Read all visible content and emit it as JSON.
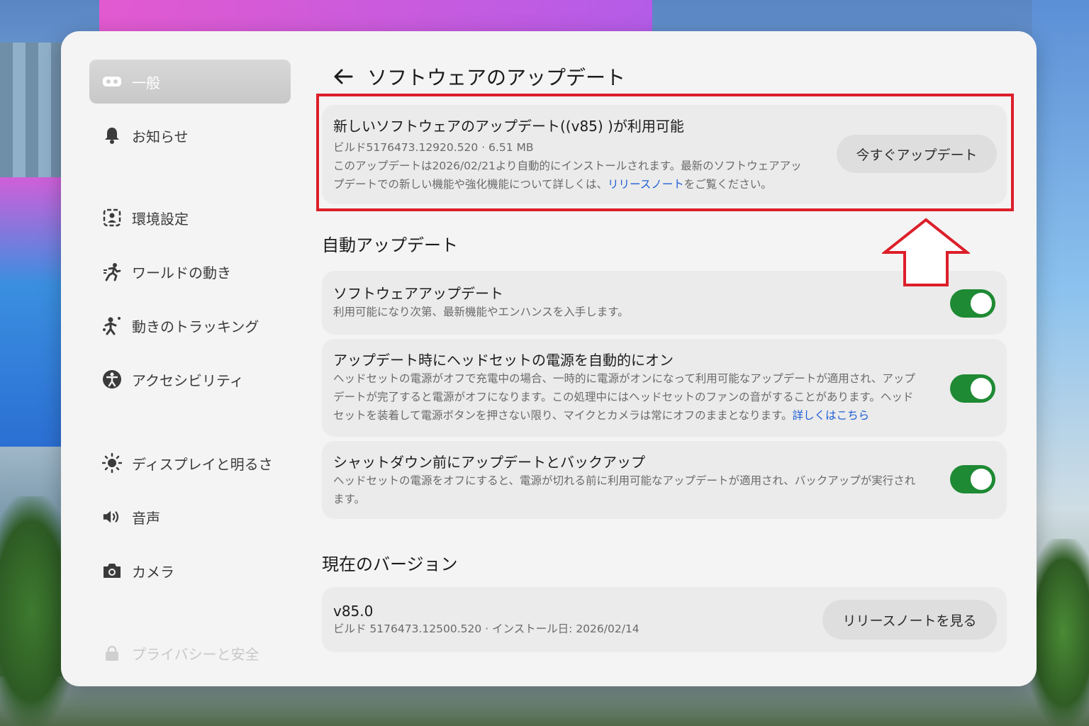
{
  "sidebar": {
    "items": [
      {
        "label": "一般",
        "icon": "headset-icon",
        "active": true
      },
      {
        "label": "お知らせ",
        "icon": "bell-icon"
      },
      {
        "label": "環境設定",
        "icon": "environment-icon"
      },
      {
        "label": "ワールドの動き",
        "icon": "running-person-icon"
      },
      {
        "label": "動きのトラッキング",
        "icon": "tracking-person-icon"
      },
      {
        "label": "アクセシビリティ",
        "icon": "accessibility-icon"
      },
      {
        "label": "ディスプレイと明るさ",
        "icon": "sun-icon"
      },
      {
        "label": "音声",
        "icon": "speaker-icon"
      },
      {
        "label": "カメラ",
        "icon": "camera-icon"
      },
      {
        "label": "プライバシーと安全",
        "icon": "lock-icon"
      }
    ]
  },
  "header": {
    "title": "ソフトウェアのアップデート"
  },
  "update_available": {
    "title": "新しいソフトウェアのアップデート((v85) )が利用可能",
    "build": "ビルド5176473.12920.520 · 6.51 MB",
    "desc_line1": "このアップデートは2026/02/21より自動的にインストールされます。最新のソフトウェアアッ",
    "desc_line2_pre": "プデートでの新しい機能や強化機能について詳しくは、",
    "desc_link": "リリースノート",
    "desc_line2_post": "をご覧ください。",
    "button": "今すぐアップデート"
  },
  "auto_update": {
    "section_title": "自動アップデート",
    "items": [
      {
        "title": "ソフトウェアアップデート",
        "desc": "利用可能になり次第、最新機能やエンハンスを入手します。",
        "enabled": true
      },
      {
        "title": "アップデート時にヘッドセットの電源を自動的にオン",
        "desc_line1": "ヘッドセットの電源がオフで充電中の場合、一時的に電源がオンになって利用可能なアップデートが適用され、アップ",
        "desc_line2": "デートが完了すると電源がオフになります。この処理中にはヘッドセットのファンの音がすることがあります。ヘッド",
        "desc_line3": "セットを装着して電源ボタンを押さない限り、マイクとカメラは常にオフのままとなります。",
        "link": "詳しくはこちら",
        "enabled": true
      },
      {
        "title": "シャットダウン前にアップデートとバックアップ",
        "desc_line1": "ヘッドセットの電源をオフにすると、電源が切れる前に利用可能なアップデートが適用され、バックアップが実行され",
        "desc_line2": "ます。",
        "enabled": true
      }
    ]
  },
  "current_version": {
    "section_title": "現在のバージョン",
    "version": "v85.0",
    "build": "ビルド 5176473.12500.520 · インストール日: 2026/02/14",
    "button": "リリースノートを見る"
  },
  "colors": {
    "toggle_on": "#1e8a34",
    "link": "#1f5fd6",
    "highlight": "#dc1f2a"
  }
}
